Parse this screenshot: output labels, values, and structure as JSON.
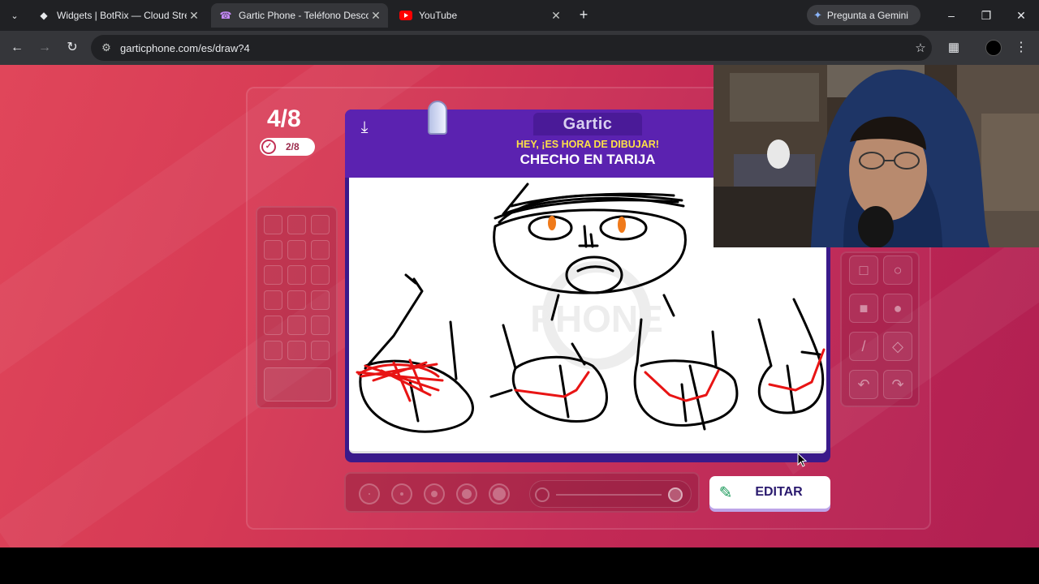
{
  "browser": {
    "tabs": [
      {
        "title": "Widgets | BotRix — Cloud Strea",
        "favicon": "botrix-icon",
        "active": false
      },
      {
        "title": "Gartic Phone - Teléfono Descon",
        "favicon": "phone-icon",
        "active": true
      },
      {
        "title": "YouTube",
        "favicon": "youtube-icon",
        "active": false
      }
    ],
    "gemini_label": "Pregunta a Gemini",
    "url": "garticphone.com/es/draw?4"
  },
  "game": {
    "round_counter": "4/8",
    "done_counter": "2/8",
    "logo": "Gartic",
    "prompt_label": "HEY, ¡ES HORA DE DIBUJAR!",
    "prompt_text": "CHECHO EN TARIJA",
    "edit_button": "EDITAR",
    "watermark": "PHONE",
    "colors": {
      "accent": "#5b22b0",
      "prompt_label": "#fde047",
      "background": "#d63a55"
    }
  }
}
